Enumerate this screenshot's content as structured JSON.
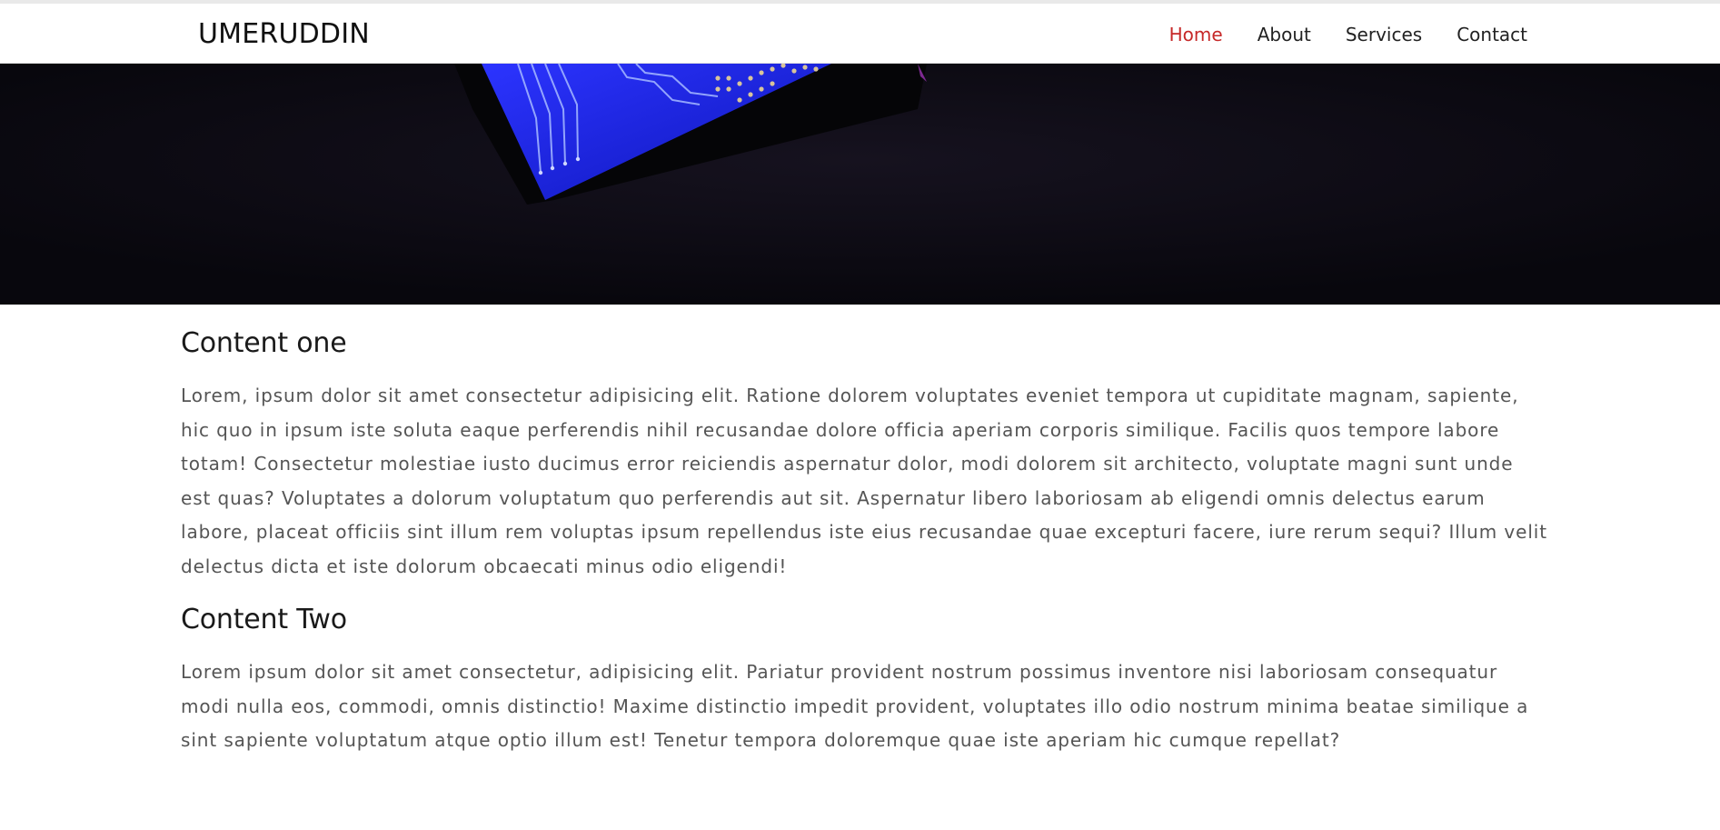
{
  "header": {
    "brand": "UMERUDDIN",
    "nav": [
      {
        "label": "Home",
        "active": true
      },
      {
        "label": "About",
        "active": false
      },
      {
        "label": "Services",
        "active": false
      },
      {
        "label": "Contact",
        "active": false
      }
    ]
  },
  "sections": [
    {
      "title": "Content one",
      "text": "Lorem, ipsum dolor sit amet consectetur adipisicing elit. Ratione dolorem voluptates eveniet tempora ut cupiditate magnam, sapiente, hic quo in ipsum iste soluta eaque perferendis nihil recusandae dolore officia aperiam corporis similique. Facilis quos tempore labore totam! Consectetur molestiae iusto ducimus error reiciendis aspernatur dolor, modi dolorem sit architecto, voluptate magni sunt unde est quas? Voluptates a dolorum voluptatum quo perferendis aut sit. Aspernatur libero laboriosam ab eligendi omnis delectus earum labore, placeat officiis sint illum rem voluptas ipsum repellendus iste eius recusandae quae excepturi facere, iure rerum sequi? Illum velit delectus dicta et iste dolorum obcaecati minus odio eligendi!"
    },
    {
      "title": "Content Two",
      "text": "Lorem ipsum dolor sit amet consectetur, adipisicing elit. Pariatur provident nostrum possimus inventore nisi laboriosam consequatur modi nulla eos, commodi, omnis distinctio! Maxime distinctio impedit provident, voluptates illo odio nostrum minima beatae similique a sint sapiente voluptatum atque optio illum est! Tenetur tempora doloremque quae iste aperiam hic cumque repellat?"
    }
  ],
  "colors": {
    "active_nav": "#c62828",
    "hero_bg": "#0b0913",
    "circuit_blue": "#1a22d8"
  }
}
